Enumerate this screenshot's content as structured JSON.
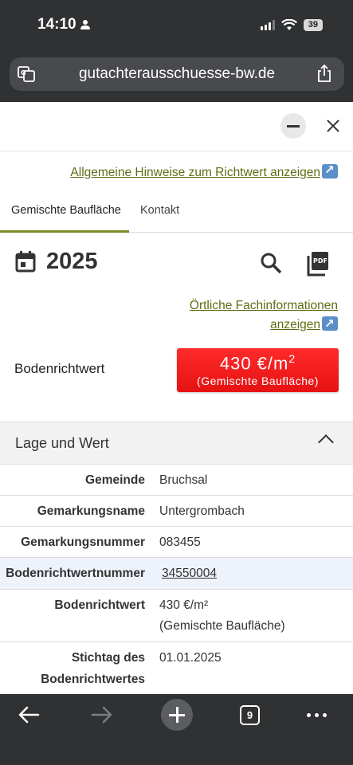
{
  "status_bar": {
    "time": "14:10",
    "battery": "39"
  },
  "browser": {
    "url": "gutachterausschuesse-bw.de",
    "tab_count": "9"
  },
  "hint_link": "Allgemeine Hinweise zum Richtwert anzeigen",
  "tabs": [
    {
      "label": "Gemischte Baufläche",
      "active": true
    },
    {
      "label": "Kontakt",
      "active": false
    }
  ],
  "year": "2025",
  "local_info_link": {
    "line1": "Örtliche Fachinformationen",
    "line2": "anzeigen"
  },
  "bodenrichtwert": {
    "label": "Bodenrichtwert",
    "value": "430 €/m",
    "exponent": "2",
    "usage": "(Gemischte Baufläche)"
  },
  "accordion": {
    "title": "Lage und Wert",
    "rows": [
      {
        "key": "Gemeinde",
        "value": "Bruchsal"
      },
      {
        "key": "Gemarkungsname",
        "value": "Untergrombach"
      },
      {
        "key": "Gemarkungsnummer",
        "value": "083455"
      },
      {
        "key": "Bodenrichtwertnummer",
        "value": "34550004"
      },
      {
        "key": "Bodenrichtwert",
        "value": "430 €/m²",
        "value2": "(Gemischte Baufläche)"
      },
      {
        "key": "Stichtag des",
        "key2": "Bodenrichtwertes",
        "value": "01.01.2025"
      }
    ]
  },
  "colors": {
    "accent": "#5e6e14",
    "badge": "#ff2020",
    "chrome": "#2f3133"
  }
}
